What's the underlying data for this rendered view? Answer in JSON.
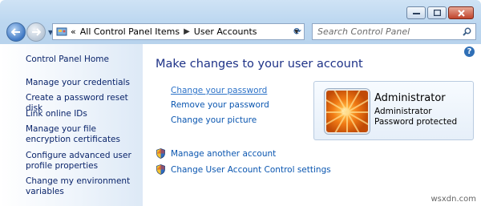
{
  "address": {
    "crumb_prefix": "«",
    "crumbs": [
      "All Control Panel Items",
      "User Accounts"
    ]
  },
  "search": {
    "placeholder": "Search Control Panel"
  },
  "sidebar": {
    "home": "Control Panel Home",
    "items": [
      "Manage your credentials",
      "Create a password reset disk",
      "Link online IDs",
      "Manage your file encryption certificates",
      "Configure advanced user profile properties",
      "Change my environment variables"
    ]
  },
  "main": {
    "title": "Make changes to your user account",
    "links": [
      "Change your password",
      "Remove your password",
      "Change your picture"
    ],
    "admin_links": [
      "Manage another account",
      "Change User Account Control settings"
    ]
  },
  "user": {
    "name": "Administrator",
    "role": "Administrator",
    "status": "Password protected"
  },
  "watermark": "wsxdn.com"
}
